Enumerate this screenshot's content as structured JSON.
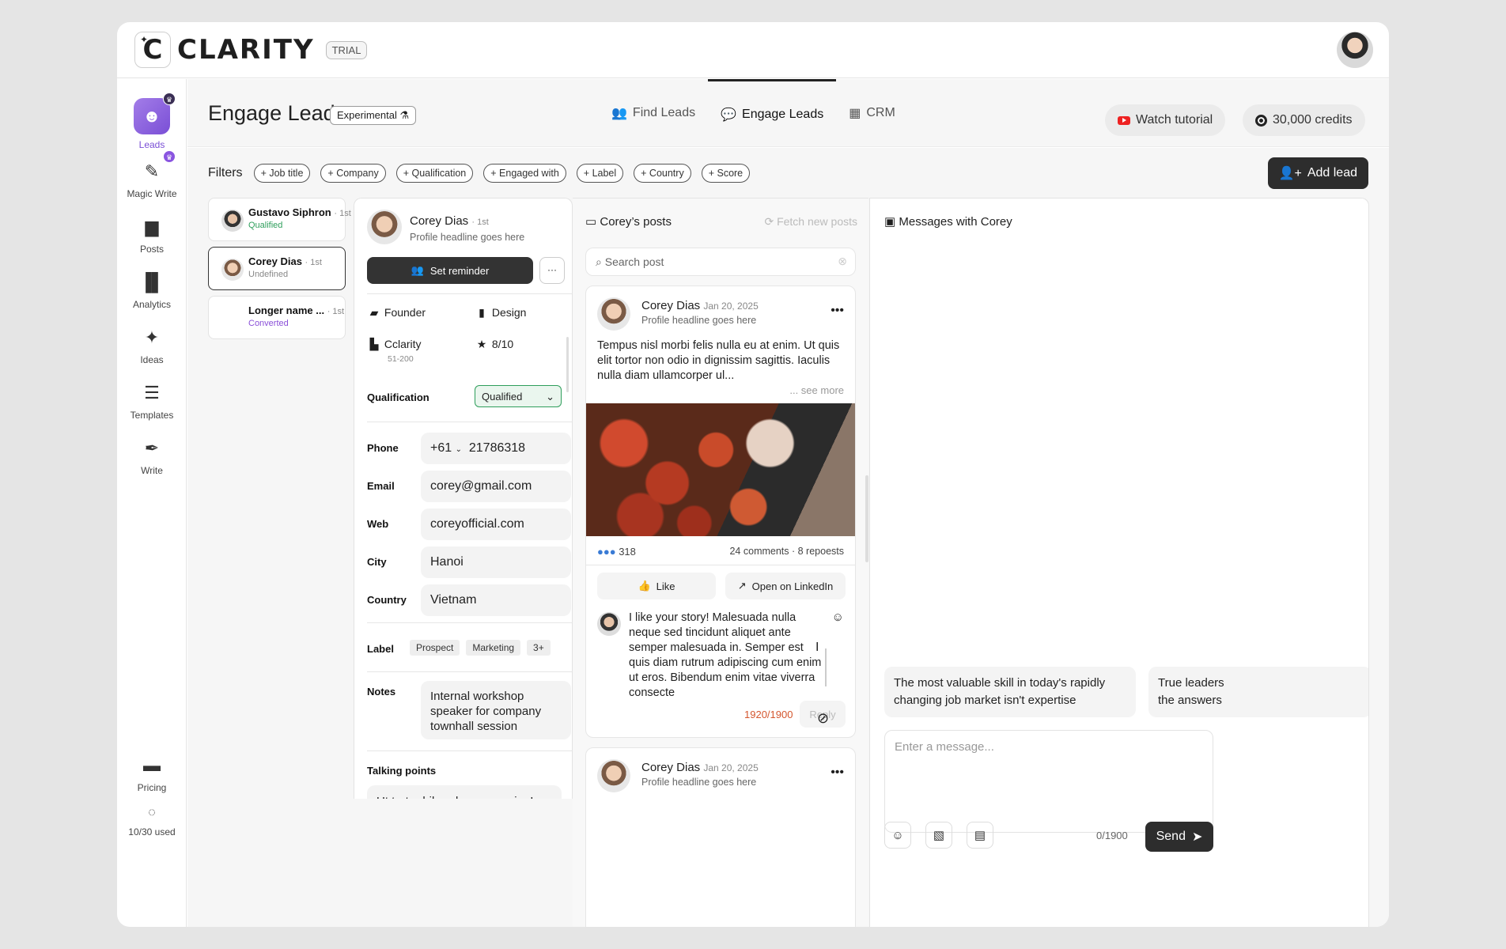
{
  "app": {
    "logo_letter": "C",
    "logo_text": "CLARITY",
    "badge": "TRIAL"
  },
  "sidebar": {
    "items": [
      {
        "label": "Leads",
        "icon": "user-icon"
      },
      {
        "label": "Magic Write",
        "icon": "magic-wand-icon"
      },
      {
        "label": "Posts",
        "icon": "posts-icon"
      },
      {
        "label": "Analytics",
        "icon": "bar-chart-icon"
      },
      {
        "label": "Ideas",
        "icon": "sparkle-icon"
      },
      {
        "label": "Templates",
        "icon": "stack-icon"
      },
      {
        "label": "Write",
        "icon": "pen-icon"
      }
    ],
    "pricing": "Pricing",
    "usage": "10/30 used"
  },
  "header": {
    "title": "Engage Leads",
    "badge": "Experimental",
    "tabs": [
      {
        "label": "Find Leads"
      },
      {
        "label": "Engage Leads"
      },
      {
        "label": "CRM"
      }
    ],
    "watch": "Watch tutorial",
    "credits": "30,000 credits"
  },
  "filters": {
    "label": "Filters",
    "chips": [
      "+ Job title",
      "+ Company",
      "+ Qualification",
      "+ Engaged with",
      "+ Label",
      "+ Country",
      "+ Score"
    ],
    "add_lead": "Add lead"
  },
  "leads": [
    {
      "name": "Gustavo Siphron",
      "degree": "· 1st",
      "status": "Qualified",
      "color": "#2e9e5b"
    },
    {
      "name": "Corey Dias",
      "degree": "· 1st",
      "status": "Undefined",
      "color": "#888888"
    },
    {
      "name": "Longer name ...",
      "degree": "· 1st",
      "status": "Converted",
      "color": "#8a4fd8"
    }
  ],
  "profile": {
    "name": "Corey Dias",
    "degree": "· 1st",
    "headline": "Profile headline goes here",
    "reminder": "Set reminder",
    "more": "···",
    "role": "Founder",
    "dept": "Design",
    "company": "Cclarity",
    "size": "51-200",
    "score": "8/10",
    "qual_label": "Qualification",
    "qual_value": "Qualified",
    "phone_label": "Phone",
    "phone_code": "+61",
    "phone": "21786318",
    "email_label": "Email",
    "email": "corey@gmail.com",
    "web_label": "Web",
    "web": "coreyofficial.com",
    "city_label": "City",
    "city": "Hanoi",
    "country_label": "Country",
    "country": "Vietnam",
    "label_label": "Label",
    "labels": [
      "Prospect",
      "Marketing",
      "3+"
    ],
    "notes_label": "Notes",
    "notes": "Internal workshop speaker for company townhall session",
    "talking_label": "Talking points",
    "talking": "Ut tortor bibendum neque in. In eget"
  },
  "posts": {
    "title": "Corey’s posts",
    "fetch": "Fetch new posts",
    "search_placeholder": "Search post",
    "author": "Corey Dias",
    "date": "Jan 20, 2025",
    "headline": "Profile headline goes here",
    "text": "Tempus nisl morbi felis nulla eu at enim. Ut quis elit tortor non odio in dignissim sagittis. Iaculis nulla diam ullamcorper ul...",
    "see_more": "... see more",
    "reactions": "318",
    "comments": "24 comments · 8 repoests",
    "like": "Like",
    "open": "Open on LinkedIn",
    "reply_text": "I like your story! Malesuada nulla neque sed tincidunt aliquet ante semper malesuada in. Semper est quis diam rutrum adipiscing cum enim ut eros. Bibendum enim vitae viverra consecte",
    "counter": "1920/1900",
    "reply": "Reply",
    "author2": "Corey Dias",
    "date2": "Jan 20, 2025",
    "headline2": "Profile headline goes here"
  },
  "messages": {
    "title": "Messages with Corey",
    "suggestions": [
      "The most valuable skill in today's rapidly\nchanging job market isn't expertise",
      "True leaders\nthe answers"
    ],
    "placeholder": "Enter a message...",
    "counter": "0/1900",
    "send": "Send"
  }
}
